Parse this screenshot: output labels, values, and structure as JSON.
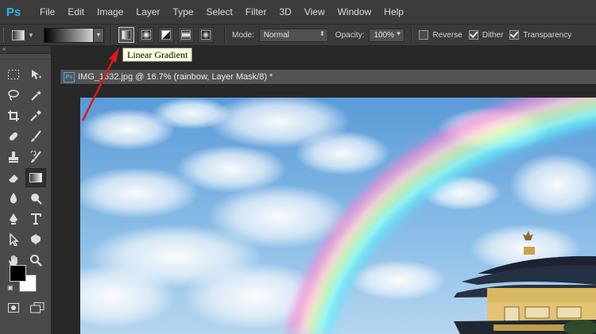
{
  "app": {
    "logo": "Ps"
  },
  "menu": [
    "File",
    "Edit",
    "Image",
    "Layer",
    "Type",
    "Select",
    "Filter",
    "3D",
    "View",
    "Window",
    "Help"
  ],
  "options": {
    "mode_label": "Mode:",
    "mode_value": "Normal",
    "opacity_label": "Opacity:",
    "opacity_value": "100%",
    "reverse_label": "Reverse",
    "reverse_checked": false,
    "dither_label": "Dither",
    "dither_checked": true,
    "transparency_label": "Transparency",
    "transparency_checked": true,
    "gradient_types": [
      "linear",
      "radial",
      "angle",
      "reflected",
      "diamond"
    ],
    "selected_gradient_type": "linear"
  },
  "tooltip": {
    "text": "Linear Gradient"
  },
  "tools_panel": {
    "collapse_glyph": "«"
  },
  "document": {
    "tab_title": "IMG_1532.jpg @ 16.7% (rainbow, Layer Mask/8) *"
  },
  "colors": {
    "accent": "#30b4f0",
    "annotation_arrow": "#e01818",
    "foreground": "#000000",
    "background": "#ffffff"
  }
}
